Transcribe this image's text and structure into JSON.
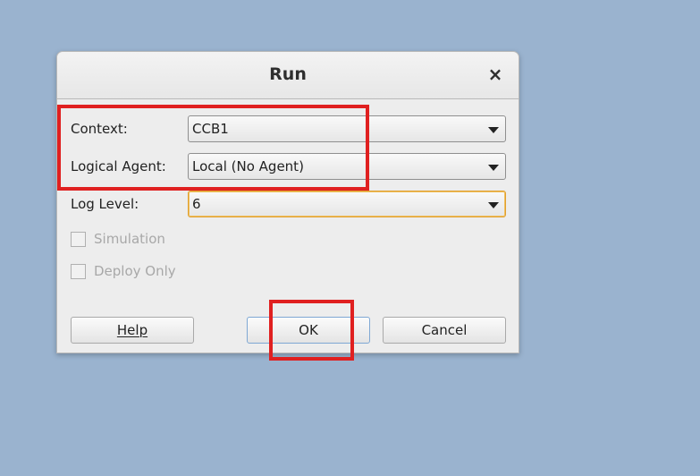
{
  "dialog": {
    "title": "Run",
    "close_glyph": "×"
  },
  "form": {
    "context_label": "Context:",
    "context_value": "CCB1",
    "agent_label": "Logical Agent:",
    "agent_value": "Local (No Agent)",
    "loglevel_label": "Log Level:",
    "loglevel_value": "6",
    "simulation_label": "Simulation",
    "deploy_label": "Deploy Only"
  },
  "buttons": {
    "help_label": "Help",
    "ok_label": "OK",
    "cancel_label": "Cancel"
  },
  "colors": {
    "desktop_bg": "#9ab3cf",
    "highlight": "#e02020",
    "focus_border": "#e0a030"
  },
  "icons": {
    "close": "close-icon",
    "dropdown": "chevron-down-icon",
    "checkbox": "checkbox-icon"
  }
}
